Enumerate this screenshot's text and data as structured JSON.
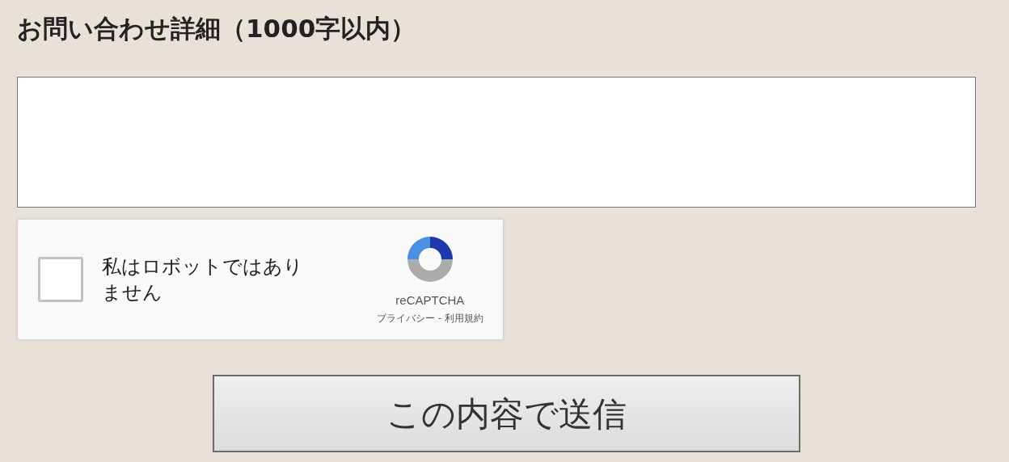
{
  "form": {
    "label": "お問い合わせ詳細（1000字以内）"
  },
  "captcha": {
    "checked": false,
    "label": "私はロボットではありません",
    "brand": "reCAPTCHA",
    "privacy": "プライバシー",
    "separator": "-",
    "terms": "利用規約"
  },
  "submit": {
    "label": "この内容で送信"
  }
}
